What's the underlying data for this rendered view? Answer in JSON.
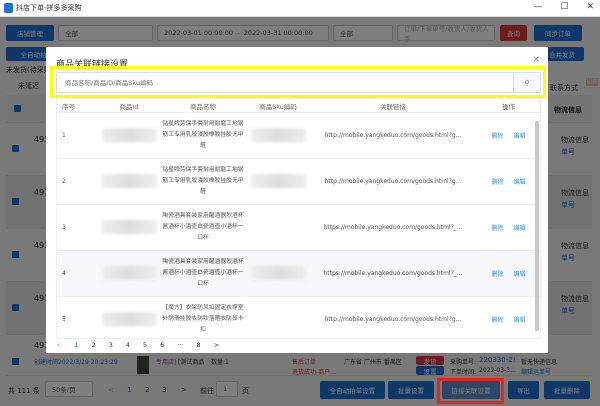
{
  "window": {
    "title": "抖店下单-拼多多采购",
    "min": "—",
    "max": "☐",
    "close": "✕"
  },
  "toolbar": {
    "shop_btn": "店铺管理",
    "shop_select": "全部",
    "date_start": "2022-03-01 00:00:00",
    "date_sep": "-",
    "date_end": "2022-03-31 00:00:00",
    "status_select": "全部",
    "order_placeholder": "订单/下单单号/收货人/收货人手",
    "query": "查询",
    "sync": "同步订单",
    "auto_btn": "全自动拍",
    "merge_btn": "合并发货",
    "tab_label": "未发货(待采购",
    "radio_label": "未延迟",
    "switch_label": "切换",
    "contact_placeholder": "联系方式",
    "col_logistics": "物流信息"
  },
  "bg_rows": [
    {
      "id": "491",
      "info": "物流信息",
      "link": "单号"
    },
    {
      "id": "491",
      "info": "物流信息",
      "link": "单号"
    },
    {
      "id": "491",
      "info": "物流信息",
      "link": "单号"
    },
    {
      "id": "491",
      "info": "物流信息",
      "link": "单号"
    }
  ],
  "bg_last_row": {
    "id": "491",
    "created": "创建时间2022/3/29 20:23:29",
    "shop": "专用店]",
    "product": "[测试商品",
    "qty": "数量:1",
    "after_sale": "售后订单",
    "refund": "退货成功-商户...",
    "address": "广东省 广州市 番禺区",
    "purchase_label": "采购单号:",
    "purchase_no": "220330-2!",
    "order_time_label": "下单时间:",
    "order_time": "2022-03-3...",
    "express": "暂无快递信息",
    "edit_waybill": "编辑运单号",
    "btn_top": "发货",
    "btn_bottom": "设置"
  },
  "footer": {
    "total": "共 111 条",
    "page_size": "50条/页",
    "pages": [
      "1",
      "2",
      "3"
    ],
    "goto": "前往",
    "goto_page": "1",
    "page_unit": "页",
    "auto_settings": "全自动拍单设置",
    "batch_settings": "批量设置",
    "link_settings": "链接关联设置",
    "export": "导出",
    "batch_delete": "批量删除"
  },
  "modal": {
    "title": "商品关联链接设置",
    "search_placeholder": "商品名称/商品ID/商品Sku编码",
    "columns": [
      "序号",
      "商品Id",
      "商品名称",
      "商品Sku编码",
      "关联链接",
      "操作"
    ],
    "rows": [
      {
        "no": "1",
        "name": "钻星牌劳保手套耐用耐磨工地钢筋工专用乳胶浸胶橡胶挂胶无甲醛",
        "link": "http://mobile.yangkeduo.com/goods.html?g...",
        "delete": "删除",
        "edit": "编辑"
      },
      {
        "no": "2",
        "name": "钻星牌劳保手套耐用耐磨工地钢筋工专用乳胶浸胶橡胶挂胶无甲醛",
        "link": "http://mobile.yangkeduo.com/goods.html?g...",
        "delete": "删除",
        "edit": "编辑"
      },
      {
        "no": "3",
        "name": "陶瓷酒具套装家用醒酒器烈酒杯酱酒杯小酒壶白瓷酒壶小酒杯一口杯",
        "link": "https://mobile.yangkeduo.com/goods.html?_...",
        "delete": "删除",
        "edit": "编辑"
      },
      {
        "no": "4",
        "name": "陶瓷酒具套装家用醒酒器烈酒杯酱酒杯小酒壶白瓷酒壶小酒杯一口杯",
        "link": "https://mobile.yangkeduo.com/goods.html?_...",
        "delete": "删除",
        "edit": "编辑"
      },
      {
        "no": "5",
        "name": "【魔方】衣架防风扣固定衣撑室外防滑挂胶衣防吹落晒衣防掉卡扣",
        "link": "http://mobile.yangkeduo.com/goods.html?g...",
        "delete": "删除",
        "edit": "编辑"
      }
    ],
    "pager": {
      "prev": "<",
      "pages": [
        "1",
        "2",
        "3",
        "4",
        "5",
        "6"
      ],
      "ellipsis": "···",
      "last": "8",
      "next": ">"
    }
  }
}
